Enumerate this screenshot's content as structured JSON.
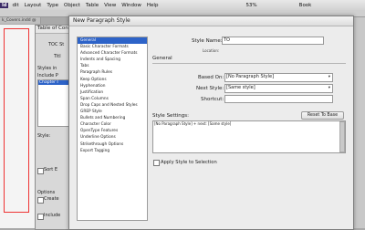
{
  "menubar": {
    "logo": "Id",
    "items": [
      "dit",
      "Layout",
      "Type",
      "Object",
      "Table",
      "View",
      "Window",
      "Help"
    ],
    "zoom": "53%",
    "workspace": "Book"
  },
  "doc_tab": {
    "label": "k_Covers.indd @"
  },
  "toc_dialog": {
    "title": "Table of Con",
    "toc_style_label": "TOC St",
    "title_label": "Titl",
    "styles_in_label": "Styles in",
    "include_label": "Include P",
    "selected_item": "Chapter I",
    "style_label": "Style:",
    "options_label": "Options",
    "sort_label": "Sort E",
    "create_label": "Create",
    "include2_label": "Include"
  },
  "dialog": {
    "title": "New Paragraph Style",
    "categories": [
      "General",
      "Basic Character Formats",
      "Advanced Character Formats",
      "Indents and Spacing",
      "Tabs",
      "Paragraph Rules",
      "Keep Options",
      "Hyphenation",
      "Justification",
      "Span Columns",
      "Drop Caps and Nested Styles",
      "GREP Style",
      "Bullets and Numbering",
      "Character Color",
      "OpenType Features",
      "Underline Options",
      "Strikethrough Options",
      "Export Tagging"
    ],
    "selected_category": "General",
    "style_name_label": "Style Name:",
    "style_name_value": "TO",
    "location_label": "Location:",
    "general_heading": "General",
    "based_on_label": "Based On:",
    "based_on_value": "[No Paragraph Style]",
    "next_style_label": "Next Style:",
    "next_style_value": "[Same style]",
    "shortcut_label": "Shortcut:",
    "shortcut_value": "",
    "settings_label": "Style Settings:",
    "reset_button": "Reset To Base",
    "settings_text": "[No Paragraph Style] + next: [Same style]",
    "apply_checkbox_label": "Apply Style to Selection"
  },
  "colors": {
    "selection": "#2d63c8",
    "dialog_bg": "#ececec"
  }
}
